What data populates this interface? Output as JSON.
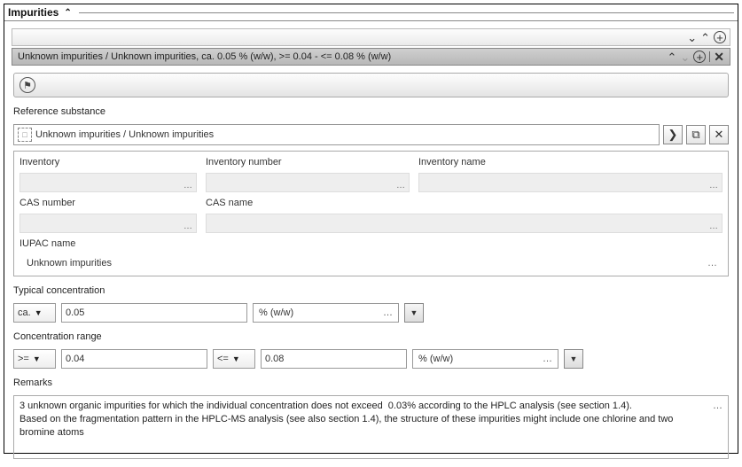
{
  "section": {
    "title": "Impurities"
  },
  "item": {
    "header": "Unknown impurities / Unknown impurities, ca. 0.05 % (w/w), >= 0.04 - <= 0.08 % (w/w)"
  },
  "reference": {
    "label": "Reference substance",
    "value": "Unknown impurities / Unknown impurities"
  },
  "info": {
    "inventory_label": "Inventory",
    "inventory_number_label": "Inventory number",
    "inventory_name_label": "Inventory name",
    "cas_number_label": "CAS number",
    "cas_name_label": "CAS name",
    "iupac_label": "IUPAC name",
    "iupac_value": "Unknown impurities"
  },
  "typical": {
    "label": "Typical concentration",
    "op": "ca.",
    "value": "0.05",
    "unit": "% (w/w)"
  },
  "range": {
    "label": "Concentration range",
    "min_op": ">=",
    "min_val": "0.04",
    "max_op": "<=",
    "max_val": "0.08",
    "unit": "% (w/w)"
  },
  "remarks": {
    "label": "Remarks",
    "text": "3 unknown organic impurities for which the individual concentration does not exceed  0.03% according to the HPLC analysis (see section 1.4).\nBased on the fragmentation pattern in the HPLC-MS analysis (see also section 1.4), the structure of these impurities might include one chlorine and two bromine atoms"
  }
}
